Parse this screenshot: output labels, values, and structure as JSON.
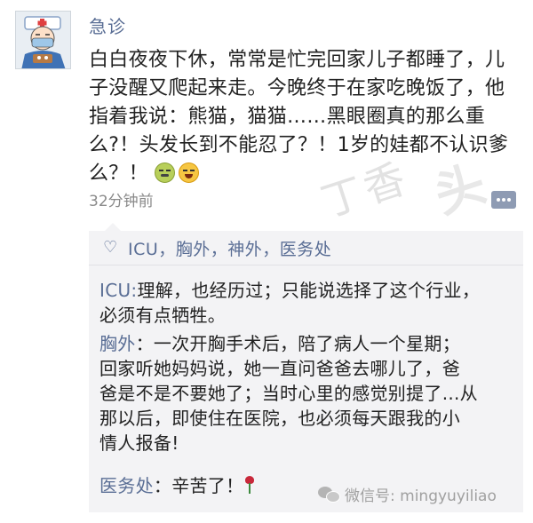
{
  "post": {
    "author": "急诊",
    "text_lines": [
      "白白夜夜下休，常常是忙完回家儿子都睡了，儿",
      "子没醒又爬起来走。今晚终于在家吃晚饭了，他",
      "指着我说：熊猫，猫猫……黑眼圈真的那么重",
      "么?！头发长到不能忍了？！1岁的娃都不认识爹",
      "么？！"
    ],
    "emojis": [
      "angry-face-icon",
      "laughing-face-icon"
    ],
    "time": "32分钟前"
  },
  "likes": {
    "icon": "heart-icon",
    "text": "ICU，胸外，神外，医务处"
  },
  "comments": [
    {
      "name": "ICU:",
      "lines": [
        "理解，也经历过；只能说选择了这个行业，",
        "必须有点牺牲。"
      ]
    },
    {
      "name": "胸外",
      "lines": [
        "：一次开胸手术后，陪了病人一个星期；",
        "回家听她妈妈说，她一直问爸爸去哪儿了，爸",
        "爸是不是不要她了；当时心里的感觉别提了...从",
        "那以后，即使住在医院，也必须每天跟我的小",
        "情人报备!"
      ]
    },
    {
      "name": "医务处",
      "lines": [
        "：辛苦了！"
      ]
    }
  ],
  "watermarks": {
    "site_1": "丁香",
    "site_2": "头条",
    "wechat": "微信号: mingyuyiliao"
  },
  "colors": {
    "name_blue": "#5a6e95",
    "comment_bg": "#f3f3f5",
    "time_gray": "#8a8a8a"
  }
}
